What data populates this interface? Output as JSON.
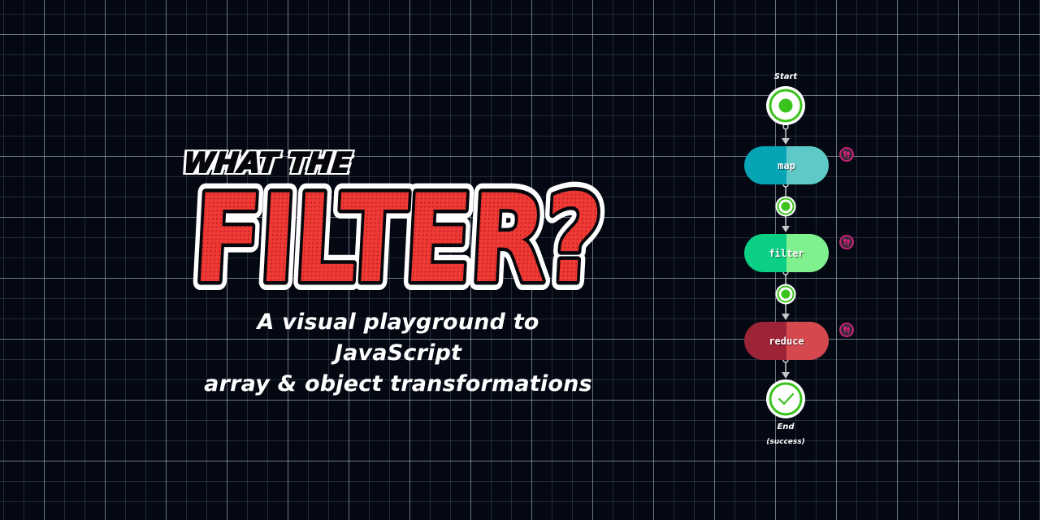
{
  "title": {
    "kicker": "WHAT THE",
    "main": "FILTER?",
    "subtitle_line1": "A visual playground to JavaScript",
    "subtitle_line2": "array & object transformations"
  },
  "flow": {
    "start_label": "Start",
    "end_label": "End",
    "end_status": "(success)",
    "steps": [
      {
        "label": "map",
        "color_left": "#06a4b5",
        "color_right": "#5fc9c7",
        "badge_icon": "footprints-icon"
      },
      {
        "label": "filter",
        "color_left": "#0ccf86",
        "color_right": "#7ff28f",
        "badge_icon": "footprints-icon"
      },
      {
        "label": "reduce",
        "color_left": "#9d2337",
        "color_right": "#d5494e",
        "badge_icon": "footprints-icon"
      }
    ],
    "node_color": "#3ac21d",
    "connector_color": "#c8c8cc",
    "badge_color": "#c4227a"
  },
  "colors": {
    "background": "#030812",
    "title_red": "#e8332f"
  }
}
